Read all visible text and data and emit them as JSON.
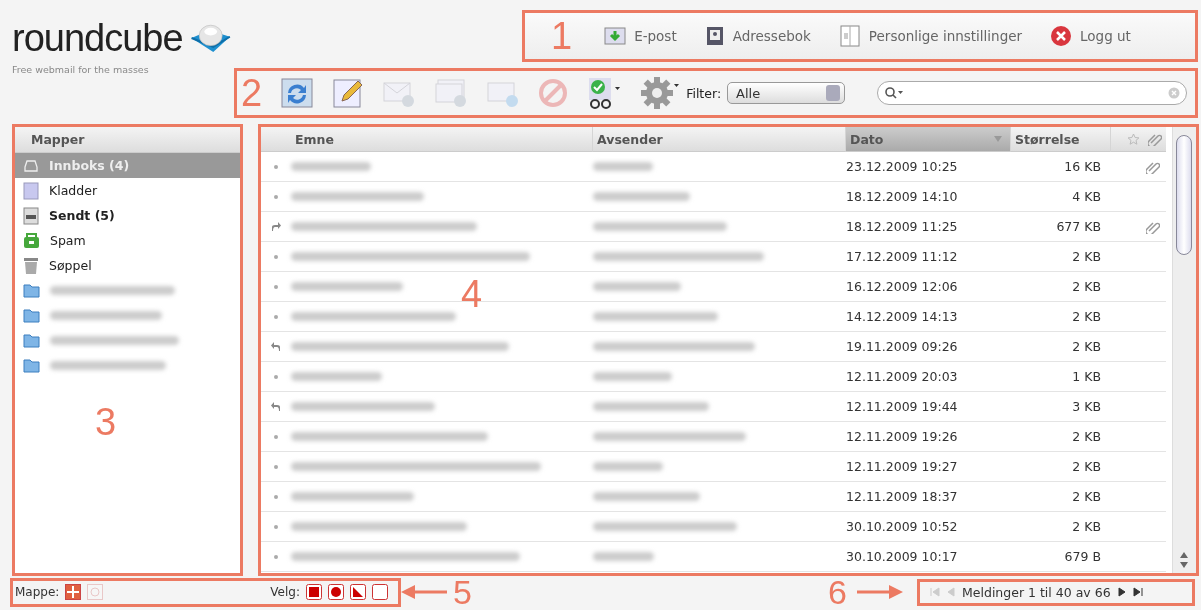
{
  "logo": {
    "name": "roundcube",
    "tagline": "Free webmail for the masses"
  },
  "callouts": [
    "1",
    "2",
    "3",
    "4",
    "5",
    "6"
  ],
  "top_nav": [
    {
      "label": "E-post",
      "kind": "mail"
    },
    {
      "label": "Adressebok",
      "kind": "addressbook"
    },
    {
      "label": "Personlige innstillinger",
      "kind": "settings"
    },
    {
      "label": "Logg ut",
      "kind": "logout"
    }
  ],
  "toolbar": {
    "buttons": [
      {
        "kind": "refresh",
        "disabled": false
      },
      {
        "kind": "compose",
        "disabled": false
      },
      {
        "kind": "reply",
        "disabled": true
      },
      {
        "kind": "reply_all",
        "disabled": true
      },
      {
        "kind": "forward",
        "disabled": true
      },
      {
        "kind": "delete",
        "disabled": true
      },
      {
        "kind": "mark",
        "disabled": false
      },
      {
        "kind": "more",
        "disabled": false
      }
    ],
    "filter_label": "Filter:",
    "filter_value": "Alle"
  },
  "folders": {
    "title": "Mapper",
    "items": [
      {
        "label": "Innboks (4)",
        "kind": "inbox",
        "selected": true,
        "unread": true
      },
      {
        "label": "Kladder",
        "kind": "drafts",
        "selected": false,
        "unread": false
      },
      {
        "label": "Sendt (5)",
        "kind": "sent",
        "selected": false,
        "unread": true
      },
      {
        "label": "Spam",
        "kind": "junk",
        "selected": false,
        "unread": false
      },
      {
        "label": "Søppel",
        "kind": "trash",
        "selected": false,
        "unread": false
      },
      {
        "kind": "folder",
        "selected": false
      },
      {
        "kind": "folder",
        "selected": false
      },
      {
        "kind": "folder",
        "selected": false
      },
      {
        "kind": "folder",
        "selected": false
      }
    ]
  },
  "messages": {
    "columns": [
      {
        "label": "Emne",
        "sorted": false
      },
      {
        "label": "Avsender",
        "sorted": false
      },
      {
        "label": "Dato",
        "sorted": true
      },
      {
        "label": "Størrelse",
        "sorted": false
      }
    ],
    "rows": [
      {
        "kind": "read",
        "date": "23.12.2009 10:25",
        "size": "16 KB",
        "attachment": true
      },
      {
        "kind": "read",
        "date": "18.12.2009 14:10",
        "size": "4 KB",
        "attachment": false
      },
      {
        "kind": "forwarded",
        "date": "18.12.2009 11:25",
        "size": "677 KB",
        "attachment": true
      },
      {
        "kind": "read",
        "date": "17.12.2009 11:12",
        "size": "2 KB",
        "attachment": false
      },
      {
        "kind": "read",
        "date": "16.12.2009 12:06",
        "size": "2 KB",
        "attachment": false
      },
      {
        "kind": "read",
        "date": "14.12.2009 14:13",
        "size": "2 KB",
        "attachment": false
      },
      {
        "kind": "replied",
        "date": "19.11.2009 09:26",
        "size": "2 KB",
        "attachment": false
      },
      {
        "kind": "read",
        "date": "12.11.2009 20:03",
        "size": "1 KB",
        "attachment": false
      },
      {
        "kind": "replied",
        "date": "12.11.2009 19:44",
        "size": "3 KB",
        "attachment": false
      },
      {
        "kind": "read",
        "date": "12.11.2009 19:26",
        "size": "2 KB",
        "attachment": false
      },
      {
        "kind": "read",
        "date": "12.11.2009 19:27",
        "size": "2 KB",
        "attachment": false
      },
      {
        "kind": "read",
        "date": "12.11.2009 18:37",
        "size": "2 KB",
        "attachment": false
      },
      {
        "kind": "read",
        "date": "30.10.2009 10:52",
        "size": "2 KB",
        "attachment": false
      },
      {
        "kind": "read",
        "date": "30.10.2009 10:17",
        "size": "679 B",
        "attachment": false
      }
    ]
  },
  "footer": {
    "folder_label": "Mappe:",
    "folder_buttons": [
      {
        "disabled": false
      },
      {
        "disabled": true
      }
    ],
    "select_label": "Velg:",
    "select_buttons": [
      {
        "kind": "all"
      },
      {
        "kind": "current"
      },
      {
        "kind": "unread"
      },
      {
        "kind": "none"
      }
    ],
    "pager": [
      {
        "kind": "first",
        "disabled": true
      },
      {
        "kind": "prev",
        "disabled": true
      },
      {
        "kind": "next",
        "disabled": false
      },
      {
        "kind": "last",
        "disabled": false
      }
    ],
    "count_text": "Meldinger 1 til 40 av 66"
  }
}
